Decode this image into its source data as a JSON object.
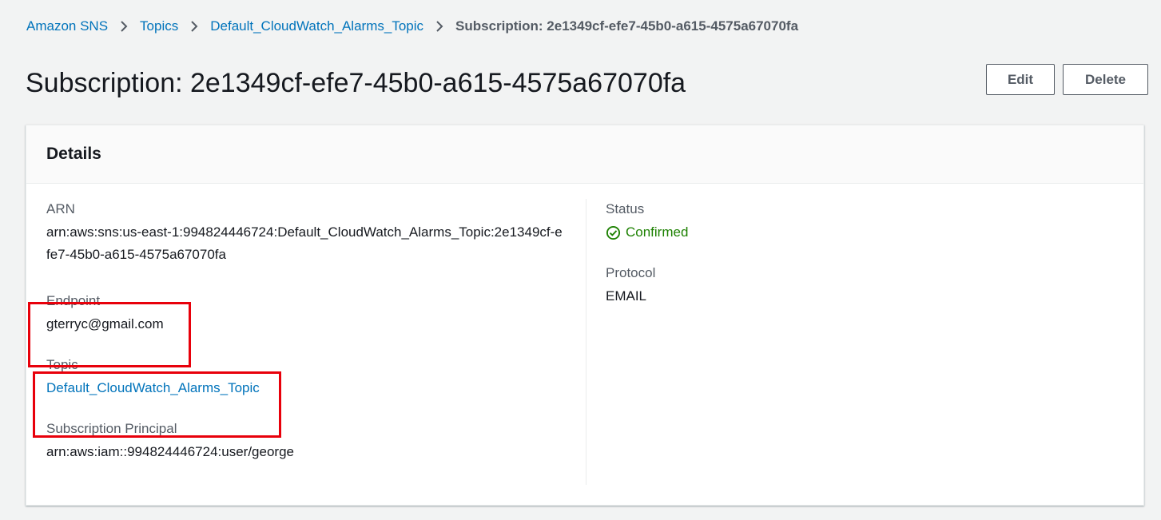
{
  "breadcrumb": {
    "items": [
      "Amazon SNS",
      "Topics",
      "Default_CloudWatch_Alarms_Topic"
    ],
    "current": "Subscription: 2e1349cf-efe7-45b0-a615-4575a67070fa"
  },
  "page": {
    "title": "Subscription: 2e1349cf-efe7-45b0-a615-4575a67070fa"
  },
  "actions": {
    "edit_label": "Edit",
    "delete_label": "Delete"
  },
  "details": {
    "heading": "Details",
    "arn": {
      "label": "ARN",
      "value": "arn:aws:sns:us-east-1:994824446724:Default_CloudWatch_Alarms_Topic:2e1349cf-efe7-45b0-a615-4575a67070fa"
    },
    "endpoint": {
      "label": "Endpoint",
      "value": "gterryc@gmail.com"
    },
    "topic": {
      "label": "Topic",
      "value": "Default_CloudWatch_Alarms_Topic"
    },
    "principal": {
      "label": "Subscription Principal",
      "value": "arn:aws:iam::994824446724:user/george"
    },
    "status": {
      "label": "Status",
      "value": "Confirmed",
      "icon": "check-circle-icon"
    },
    "protocol": {
      "label": "Protocol",
      "value": "EMAIL"
    }
  },
  "colors": {
    "link": "#0073bb",
    "success": "#1d8102",
    "highlight": "#e8000b",
    "background": "#f2f3f3"
  }
}
